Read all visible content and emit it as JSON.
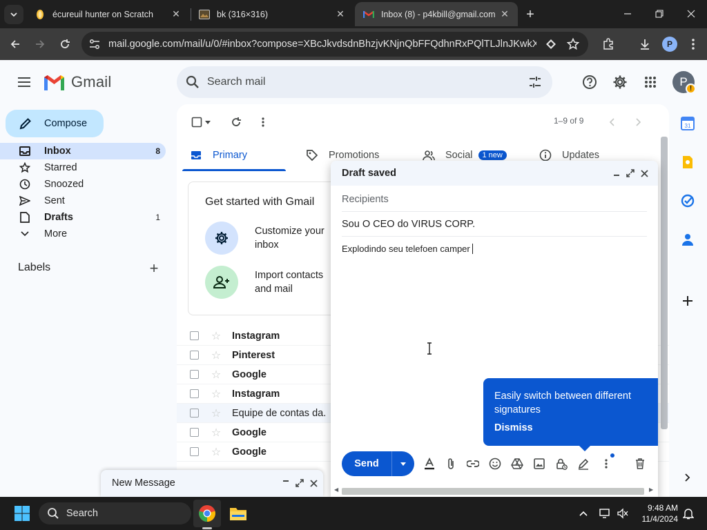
{
  "browser": {
    "tabs": [
      {
        "title": "écureuil hunter on Scratch"
      },
      {
        "title": "bk (316×316)"
      },
      {
        "title": "Inbox (8) - p4kbill@gmail.com"
      }
    ],
    "url": "mail.google.com/mail/u/0/#inbox?compose=XBcJkvdsdnBhzjvKNjnQbFFQdhnRxPQlTLJlnJKwkXWR..."
  },
  "gmail": {
    "logo_text": "Gmail",
    "search_placeholder": "Search mail",
    "avatar_initial": "P",
    "compose_label": "Compose",
    "nav": [
      {
        "label": "Inbox",
        "count": "8"
      },
      {
        "label": "Starred",
        "count": ""
      },
      {
        "label": "Snoozed",
        "count": ""
      },
      {
        "label": "Sent",
        "count": ""
      },
      {
        "label": "Drafts",
        "count": "1"
      },
      {
        "label": "More",
        "count": ""
      }
    ],
    "labels_title": "Labels",
    "pager": "1–9 of 9",
    "category_tabs": [
      {
        "label": "Primary"
      },
      {
        "label": "Promotions"
      },
      {
        "label": "Social",
        "badge": "1 new"
      },
      {
        "label": "Updates"
      }
    ],
    "get_started": {
      "title": "Get started with Gmail",
      "items": [
        "Customize your inbox",
        "Import contacts and mail"
      ]
    },
    "emails": [
      {
        "sender": "Instagram",
        "read": false
      },
      {
        "sender": "Pinterest",
        "read": false
      },
      {
        "sender": "Google",
        "read": false
      },
      {
        "sender": "Instagram",
        "read": false
      },
      {
        "sender": "Equipe de contas da.",
        "read": true
      },
      {
        "sender": "Google",
        "read": false
      },
      {
        "sender": "Google",
        "read": false
      }
    ]
  },
  "compose": {
    "title": "Draft saved",
    "recipients_placeholder": "Recipients",
    "subject": "Sou O CEO do VIRUS CORP.",
    "body": "Explodindo seu telefoen camper",
    "tip_text": "Easily switch between different signatures",
    "tip_dismiss": "Dismiss",
    "send_label": "Send"
  },
  "minimized": {
    "title": "New Message"
  },
  "taskbar": {
    "search_label": "Search",
    "time": "9:48 AM",
    "date": "11/4/2024"
  }
}
